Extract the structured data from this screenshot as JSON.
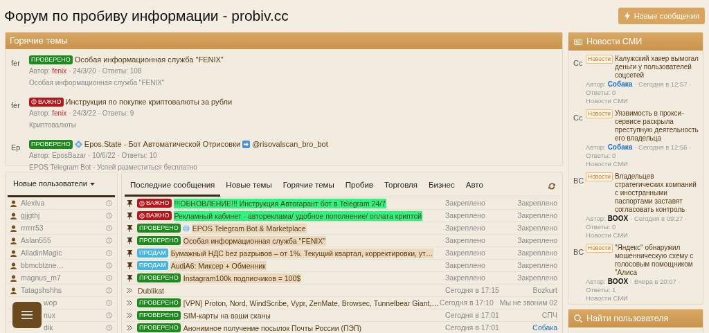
{
  "header": {
    "title": "Форум по пробиву информации - probiv.cc",
    "button": "Новые сообщения"
  },
  "hot_topics": {
    "title": "Горячие темы",
    "items": [
      {
        "avatar": "fer",
        "badge": {
          "text": "ПРОВЕРЕНО",
          "color": "#1d8a1d"
        },
        "title_parts": [
          {
            "kind": "text",
            "text": "Особая информационная служба \"FENIX\""
          }
        ],
        "author_label": "Автор:",
        "author": "fenix",
        "color": "#d42a2a",
        "meta": "· 24/3/20 · Ответы: 108",
        "desc": "Особая информационная служба \"FENIX\""
      },
      {
        "avatar": "fer",
        "badge": {
          "text": "ВАЖНО",
          "color": "#b3161b",
          "alert": true
        },
        "title_parts": [
          {
            "kind": "text",
            "text": "Инструкция по покупке криптовалюты за рубли"
          }
        ],
        "author_label": "Автор:",
        "author": "fenix",
        "color": "#d42a2a",
        "meta": "· 24/3/22 · Ответы: 9",
        "desc": "Криптовалюты"
      },
      {
        "avatar": "Ep",
        "badge": {
          "text": "ПРОВЕРЕНО",
          "color": "#1d8a1d"
        },
        "title_parts": [
          {
            "kind": "diamond"
          },
          {
            "kind": "text",
            "text": "Epos.State - Бот Автоматической Отрисовки"
          },
          {
            "kind": "arrow"
          },
          {
            "kind": "text",
            "text": "@risovalscan_bro_bot"
          }
        ],
        "author_label": "Автор:",
        "author": "EposBazar",
        "color": "#8a8a8a",
        "meta": "· 10/6/22 · Ответы: 10",
        "desc": "EPOS Telegram Bot - Успей разместиться бесплатно"
      }
    ]
  },
  "new_users": {
    "title": "Новые пользователи",
    "items": [
      {
        "name": "AlexIva",
        "covered": false
      },
      {
        "name": "gjjgthj",
        "covered": false
      },
      {
        "name": "rrrrrr53",
        "covered": false
      },
      {
        "name": "Aslan555",
        "covered": false
      },
      {
        "name": "AlladinMagic",
        "covered": false
      },
      {
        "name": "bbmcbtzne…",
        "covered": false
      },
      {
        "name": "magnus_m7",
        "covered": false
      },
      {
        "name": "Tatagshshhs",
        "covered": false
      },
      {
        "name": "wop",
        "covered": true
      },
      {
        "name": "nux",
        "covered": true
      },
      {
        "name": "dik",
        "covered": true
      }
    ]
  },
  "tabs": [
    {
      "label": "Последние сообщения",
      "selected": true
    },
    {
      "label": "Новые темы",
      "selected": false
    },
    {
      "label": "Горячие темы",
      "selected": false
    },
    {
      "label": "Пробив",
      "selected": false
    },
    {
      "label": "Торговля",
      "selected": false
    },
    {
      "label": "Бизнес",
      "selected": false
    },
    {
      "label": "Авто",
      "selected": false
    }
  ],
  "messages": [
    {
      "kind": "pinned",
      "badge": {
        "text": "ВАЖНО",
        "color": "#b3161b",
        "alert": true
      },
      "globe": false,
      "title": {
        "text": "!!!ОБНОВЛЕНИЕ!!! Инструкция Автогарант бот в Telegram 24/7",
        "color": "#2cf582"
      },
      "date": "Закреплено",
      "author": {
        "text": "Закреплено",
        "color": "#8a8a8a"
      }
    },
    {
      "kind": "pinned",
      "badge": {
        "text": "ВАЖНО",
        "color": "#b3161b",
        "alert": true
      },
      "globe": false,
      "title": {
        "text": "Рекламный кабинет - автореклама/ удобное пополнение/ оплата криптой",
        "color": "#2cf582"
      },
      "date": "Закреплено",
      "author": {
        "text": "Закреплено",
        "color": "#8a8a8a"
      }
    },
    {
      "kind": "pinned",
      "badge": {
        "text": "ПРОВЕРЕНО",
        "color": "#1d8a1d"
      },
      "globe": true,
      "title": {
        "text": "EPOS Telegram Bot & Marketplace",
        "color": "#ead9bd"
      },
      "date": "Закреплено",
      "author": {
        "text": "Закреплено",
        "color": "#8a8a8a"
      }
    },
    {
      "kind": "pinned",
      "badge": {
        "text": "ПРОВЕРЕНО",
        "color": "#1d8a1d"
      },
      "globe": false,
      "title": {
        "text": "Особая информационная служба \"FENIX\"",
        "color": "#ead9bd"
      },
      "date": "Закреплено",
      "author": {
        "text": "Закреплено",
        "color": "#8a8a8a"
      }
    },
    {
      "kind": "pinned",
      "badge": {
        "text": "ПРОДАМ",
        "color": "#45b6e3"
      },
      "globe": false,
      "title": {
        "text": "Бумажный НДС bez pazpывов – от 1%. Текущий квартал, корректировки, ут…",
        "color": "#ead9bd"
      },
      "date": "Закреплено",
      "author": {
        "text": "Закреплено",
        "color": "#8a8a8a"
      }
    },
    {
      "kind": "pinned",
      "badge": {
        "text": "ПРОДАМ",
        "color": "#45b6e3"
      },
      "globe": false,
      "title": {
        "text": "AudiA6: Миксер + Обменник",
        "color": "#ead9bd"
      },
      "date": "Закреплено",
      "author": {
        "text": "Закреплено",
        "color": "#8a8a8a"
      }
    },
    {
      "kind": "pinned",
      "badge": {
        "text": "ПРОВЕРЕНО",
        "color": "#1d8a1d"
      },
      "globe": false,
      "title": {
        "text": "Instagram100k подписчиков = 100$",
        "color": "#ead9bd"
      },
      "date": "Закреплено",
      "author": {
        "text": "Закреплено",
        "color": "#8a8a8a"
      }
    },
    {
      "kind": "normal",
      "globe": false,
      "title": {
        "text": "Dublikat"
      },
      "date": "Сегодня в 17:15",
      "author": {
        "text": "Bozkurt",
        "color": "#8a8a8a"
      }
    },
    {
      "kind": "normal",
      "badge": {
        "text": "ПРОВЕРЕНО",
        "color": "#1d8a1d"
      },
      "globe": false,
      "title": {
        "text": "[VPN] Proton, Nord, WindScribe, Vypr, ZenMate, Browsec, Tunnelbear Giant,…"
      },
      "date": "Сегодня в 17:10",
      "author": {
        "text": "Мы не звоним 02",
        "color": "#8a8a8a"
      }
    },
    {
      "kind": "normal",
      "badge": {
        "text": "ПРОВЕРЕНО",
        "color": "#1d8a1d"
      },
      "globe": false,
      "title": {
        "text": "SIM-карты на ваши сканы"
      },
      "date": "Сегодня в 17:01",
      "author": {
        "text": "СПЧ",
        "color": "#8a8a8a"
      }
    },
    {
      "kind": "normal",
      "badge": {
        "text": "ПРОВЕРЕНО",
        "color": "#1d8a1d"
      },
      "globe": false,
      "title": {
        "text": "Анонимное получение посылок Почты России (ПЭП)"
      },
      "date": "Сегодня в 17:01",
      "author": {
        "text": "Собака",
        "color": "#1a6fd6"
      }
    }
  ],
  "news": {
    "title": "Новости СМИ",
    "items": [
      {
        "avatar": "Cc",
        "badge": "Новости",
        "title": "Калужский хакер вымогал деньги у пользователей соцсетей",
        "author_label": "Автор:",
        "author": "Собака",
        "color": "#1a6fd6",
        "meta": "· Сегодня в 12:57 ·",
        "replies": "Ответы: 0",
        "forum": "Новости СМИ"
      },
      {
        "avatar": "Cc",
        "badge": "Новости",
        "title": "Уязвимость в прокси-сервисе раскрыла преступную деятельность его владельца",
        "author_label": "Автор:",
        "author": "Собака",
        "color": "#1a6fd6",
        "meta": "· Сегодня в 12:56 ·",
        "replies": "Ответы: 0",
        "forum": "Новости СМИ"
      },
      {
        "avatar": "BC",
        "badge": "Новости",
        "title": "Владельцев стратегических компаний с иностранными паспортами заставят согласовать контроль",
        "author_label": "Автор:",
        "author": "BOOX",
        "color": "#111111",
        "meta": "· Сегодня в 09:27 ·",
        "replies": "Ответы: 0",
        "forum": "Новости СМИ"
      },
      {
        "avatar": "BC",
        "badge": "Новости",
        "title": "\"Яндекс\" обнаружил мошенническую схему с голосовым помощником \"Алиса",
        "author_label": "Автор:",
        "author": "BOOX",
        "color": "#111111",
        "meta": "· Вчера в 20:07 ·",
        "replies": "Ответы: 1",
        "forum": "Новости СМИ"
      }
    ]
  },
  "find_user": {
    "title": "Найти пользователя"
  }
}
